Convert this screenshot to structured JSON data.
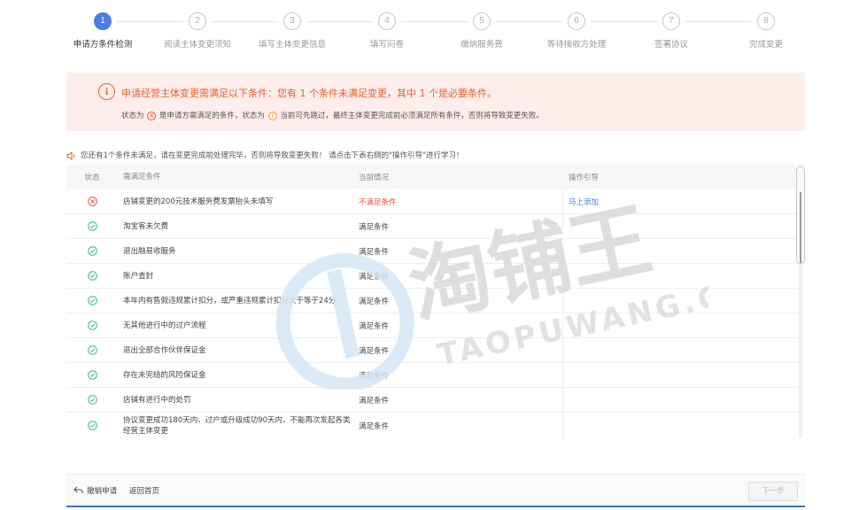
{
  "stepper": {
    "steps": [
      {
        "num": "1",
        "label": "申请方条件检测"
      },
      {
        "num": "2",
        "label": "阅读主体变更须知"
      },
      {
        "num": "3",
        "label": "填写主体变更信息"
      },
      {
        "num": "4",
        "label": "填写问卷"
      },
      {
        "num": "5",
        "label": "缴纳服务费"
      },
      {
        "num": "6",
        "label": "等待接收方处理"
      },
      {
        "num": "7",
        "label": "签署协议"
      },
      {
        "num": "8",
        "label": "完成变更"
      }
    ],
    "active_index": 0,
    "active_color": "#4a7be8"
  },
  "alert": {
    "icon": "info-circle-icon",
    "title": "申请经营主体变更需满足以下条件：您有 1 个条件未满足变更，其中 1 个是必要条件。",
    "sub_part1": "状态为",
    "sub_part2": "是申请方需满足的条件，状态为",
    "sub_part3": "当前可先跳过，最终主体变更完成前必须满足所有条件，否则将导致变更失败。",
    "title_color": "#e8602c",
    "bg_color": "#fdeeec"
  },
  "notice": {
    "icon": "speaker-icon",
    "text": "您还有1个条件未满足，请在变更完成前处理完毕，否则将导致变更失败！ 请点击下表右侧的\"操作引导\"进行学习！"
  },
  "table": {
    "headers": {
      "status": "状态",
      "condition": "需满足条件",
      "current": "当前情况",
      "guide": "操作引导"
    },
    "rows": [
      {
        "status": "fail",
        "condition": "店铺变更的200元技术服务费发票抬头未填写",
        "current": "不满足条件",
        "guide": "马上添加"
      },
      {
        "status": "ok",
        "condition": "淘宝客未欠费",
        "current": "满足条件",
        "guide": ""
      },
      {
        "status": "ok",
        "condition": "退出融易收服务",
        "current": "满足条件",
        "guide": ""
      },
      {
        "status": "ok",
        "condition": "账户查封",
        "current": "满足条件",
        "guide": ""
      },
      {
        "status": "ok",
        "condition": "本年内有售假违规累计扣分，或严重违规累计扣分大于等于24分",
        "current": "满足条件",
        "guide": ""
      },
      {
        "status": "ok",
        "condition": "无其他进行中的过户流程",
        "current": "满足条件",
        "guide": ""
      },
      {
        "status": "ok",
        "condition": "退出全部合作伙伴保证金",
        "current": "满足条件",
        "guide": ""
      },
      {
        "status": "ok",
        "condition": "存在未完结的风险保证金",
        "current": "满足条件",
        "guide": ""
      },
      {
        "status": "ok",
        "condition": "店铺有进行中的处罚",
        "current": "满足条件",
        "guide": ""
      },
      {
        "status": "ok",
        "condition": "协议变更成功180天内、过户或升级成功90天内，不能再次发起各类经营主体变更",
        "current": "满足条件",
        "guide": ""
      }
    ],
    "colors": {
      "fail": "#e8503a",
      "ok": "#3bb58f",
      "link": "#4a7be8"
    }
  },
  "watermark": {
    "logo_text": "淘铺王",
    "url_text": "TAOPUWANG.COM"
  },
  "footer": {
    "cancel_label": "撤销申请",
    "home_label": "返回首页",
    "next_label": "下一步",
    "accent_color": "#3d6fd8"
  }
}
